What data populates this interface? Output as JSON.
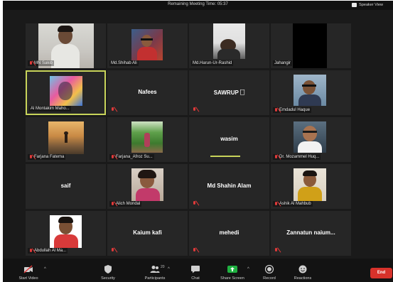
{
  "top_bar": {
    "meeting_time": "Remaining Meeting Time: 05:37",
    "speaker_view_label": "Speaker View"
  },
  "participants": [
    {
      "name": "MN Sakib",
      "big_name": "",
      "video": "photo",
      "muted": true
    },
    {
      "name": "Md.Shihab Ali",
      "big_name": "",
      "video": "photo",
      "muted": false
    },
    {
      "name": "Md.Harun-Ur-Rashid",
      "big_name": "",
      "video": "photo",
      "muted": false
    },
    {
      "name": "Jahangir",
      "big_name": "",
      "video": "dark",
      "muted": false
    },
    {
      "name": "Al Montakim Maho...",
      "big_name": "",
      "video": "photo",
      "muted": false,
      "active": true
    },
    {
      "name": "",
      "big_name": "Nafees",
      "video": "none",
      "muted": true
    },
    {
      "name": "",
      "big_name": "SAWRUP 🗌",
      "video": "none",
      "muted": true
    },
    {
      "name": "Emdadul Haque",
      "big_name": "",
      "video": "photo",
      "muted": true
    },
    {
      "name": "Farjana Fatema",
      "big_name": "",
      "video": "photo",
      "muted": true
    },
    {
      "name": "Farjana_Afroz Su...",
      "big_name": "",
      "video": "photo",
      "muted": true
    },
    {
      "name": "",
      "big_name": "wasim",
      "video": "none",
      "muted": false,
      "speaking": true
    },
    {
      "name": "Dr. Mozammel Huq...",
      "big_name": "",
      "video": "photo",
      "muted": true
    },
    {
      "name": "",
      "big_name": "saif",
      "video": "none",
      "muted": false
    },
    {
      "name": "Alich Mondal",
      "big_name": "",
      "video": "photo",
      "muted": true
    },
    {
      "name": "",
      "big_name": "Md Shahin Alam",
      "video": "none",
      "muted": true
    },
    {
      "name": "Ashik Al Mahbub",
      "big_name": "",
      "video": "photo",
      "muted": true
    },
    {
      "name": "Abdullah Al Ma...",
      "big_name": "",
      "video": "photo",
      "muted": true
    },
    {
      "name": "",
      "big_name": "Kaium kafi",
      "video": "none",
      "muted": true
    },
    {
      "name": "",
      "big_name": "mehedi",
      "video": "none",
      "muted": true
    },
    {
      "name": "",
      "big_name": "Zannatun naium...",
      "video": "none",
      "muted": true
    }
  ],
  "toolbar": {
    "start_video": "Start Video",
    "security": "Security",
    "participants": "Participants",
    "participants_count": "20",
    "chat": "Chat",
    "share_screen": "Share Screen",
    "record": "Record",
    "reactions": "Reactions",
    "end": "End"
  },
  "colors": {
    "window_bg": "#1a1a1a",
    "tile_bg": "#262626",
    "active_border": "#c8d45a",
    "muted_red": "#e13a3a",
    "share_green": "#1fb141",
    "end_red": "#d8322b"
  }
}
